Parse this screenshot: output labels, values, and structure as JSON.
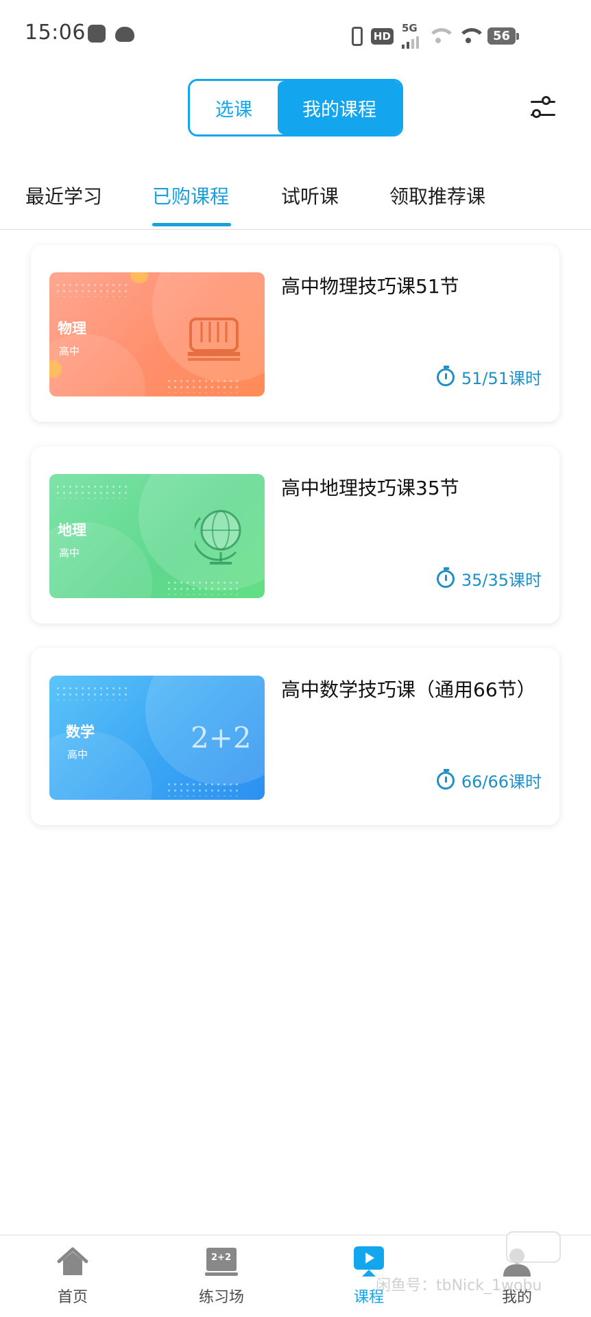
{
  "status_bar": {
    "time": "15:06",
    "network_badge": "HD",
    "network_type": "5G",
    "battery_level": "56"
  },
  "header": {
    "segments": [
      {
        "label": "选课",
        "active": false
      },
      {
        "label": "我的课程",
        "active": true
      }
    ]
  },
  "tabs": [
    {
      "label": "最近学习",
      "active": false
    },
    {
      "label": "已购课程",
      "active": true
    },
    {
      "label": "试听课",
      "active": false
    },
    {
      "label": "领取推荐课",
      "active": false
    }
  ],
  "courses": [
    {
      "subject": "物理",
      "level": "高中",
      "title": "高中物理技巧课51节",
      "progress_text": "51/51课时",
      "theme": "orange"
    },
    {
      "subject": "地理",
      "level": "高中",
      "title": "高中地理技巧课35节",
      "progress_text": "35/35课时",
      "theme": "green"
    },
    {
      "subject": "数学",
      "level": "高中",
      "title": "高中数学技巧课（通用66节）",
      "progress_text": "66/66课时",
      "theme": "blue",
      "thumb_text": "2+2"
    }
  ],
  "bottom_nav": [
    {
      "label": "首页",
      "icon": "home-icon",
      "active": false
    },
    {
      "label": "练习场",
      "icon": "blackboard-icon",
      "active": false
    },
    {
      "label": "课程",
      "icon": "play-icon",
      "active": true
    },
    {
      "label": "我的",
      "icon": "profile-icon",
      "active": false
    }
  ],
  "watermark": "闲鱼号：tbNick_1wobu",
  "colors": {
    "accent": "#13a6ee",
    "tab_active": "#1aa0dd",
    "progress": "#1e90c8"
  }
}
